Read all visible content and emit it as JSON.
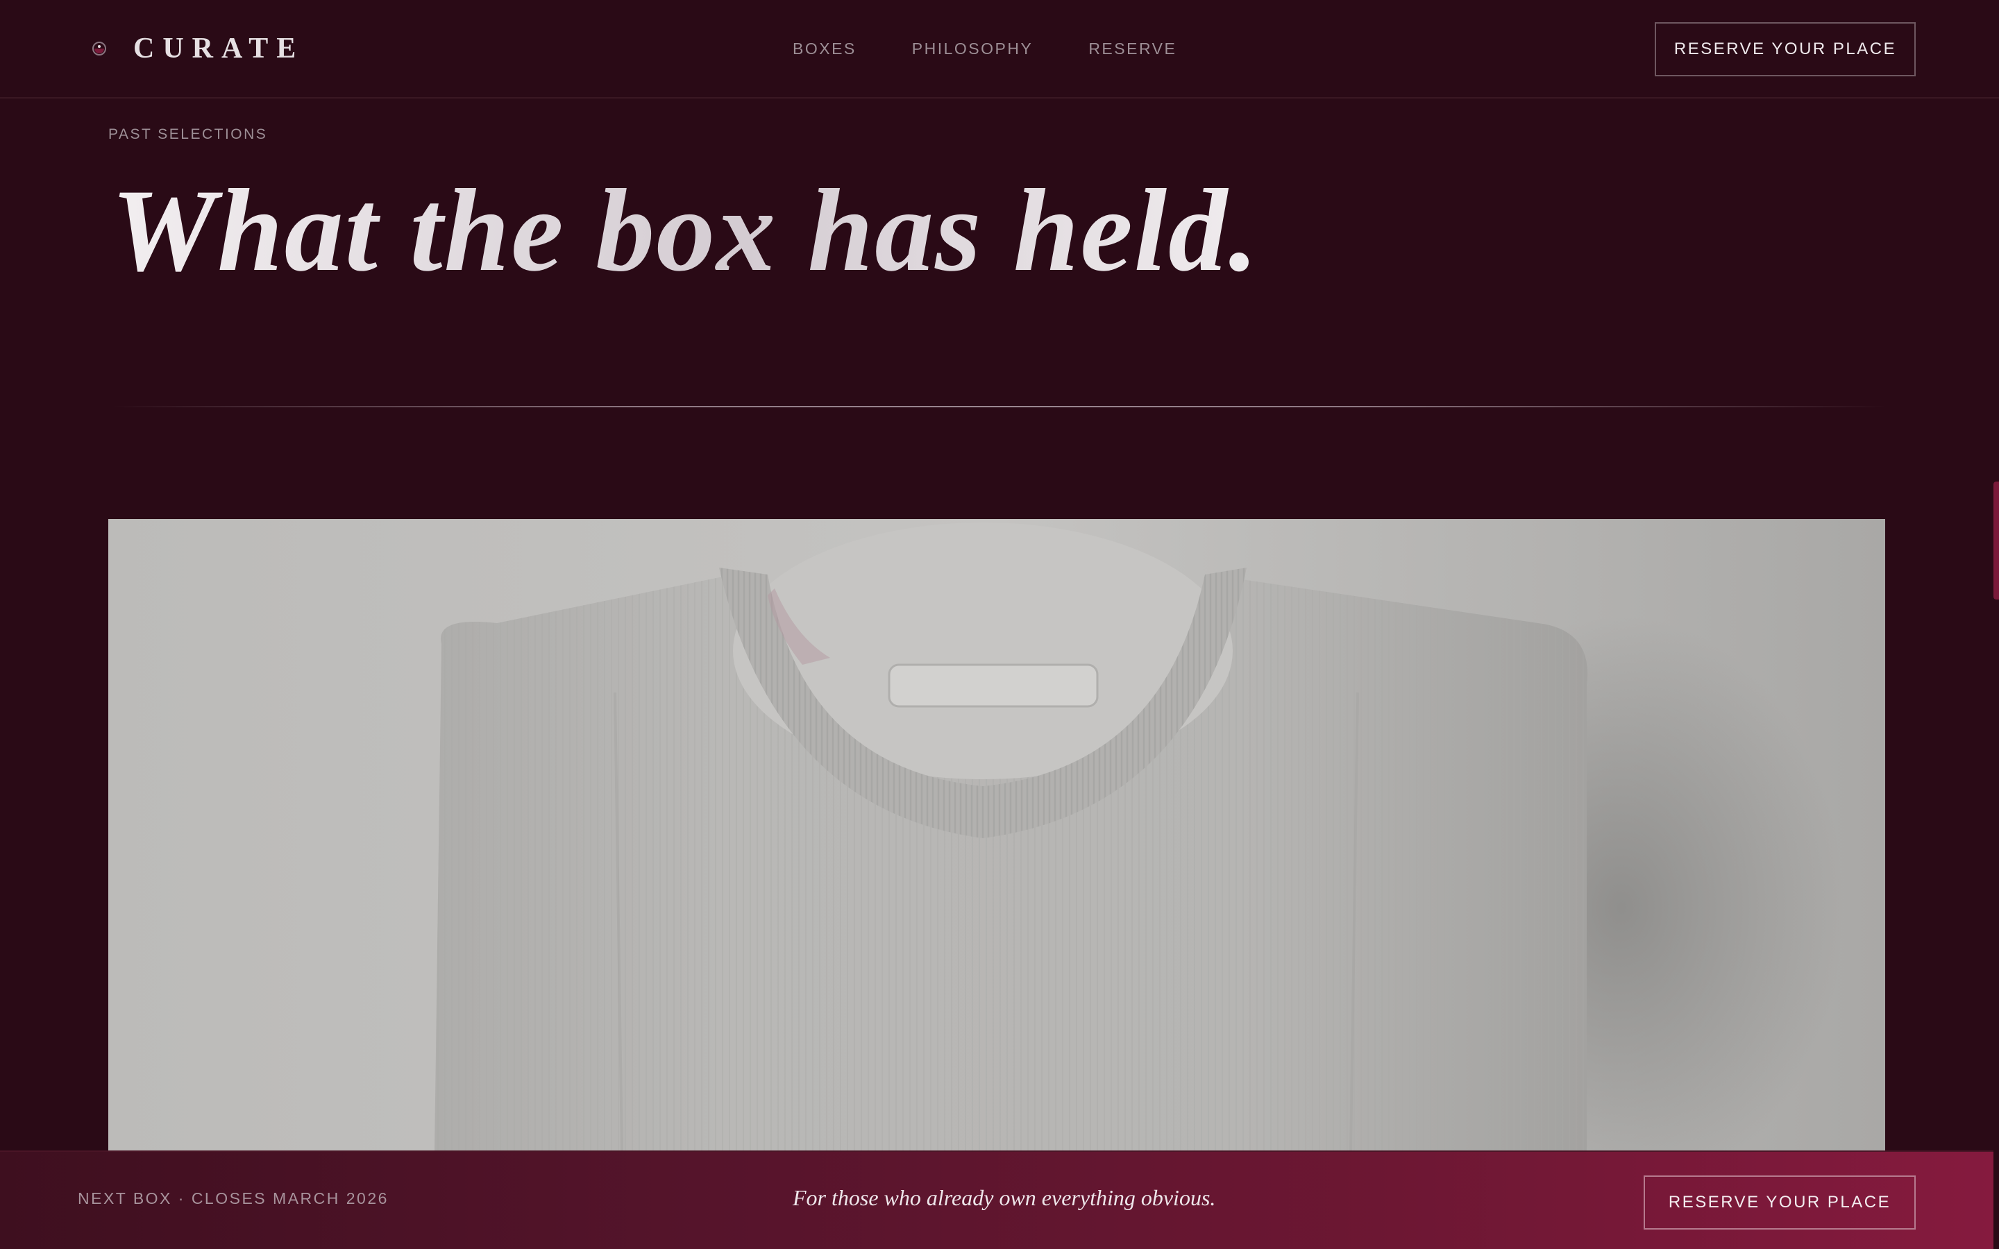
{
  "header": {
    "brand_name": "CURATE",
    "nav": [
      {
        "label": "BOXES"
      },
      {
        "label": "PHILOSOPHY"
      },
      {
        "label": "RESERVE"
      }
    ],
    "cta_label": "RESERVE YOUR PLACE"
  },
  "hero": {
    "eyebrow": "PAST SELECTIONS",
    "title": "What the box has held."
  },
  "feature": {
    "image_icon": "folded-sweater-photo"
  },
  "bottom_bar": {
    "note": "NEXT BOX · CLOSES MARCH 2026",
    "tagline": "For those who already own everything obvious.",
    "cta_label": "RESERVE YOUR PLACE"
  },
  "colors": {
    "background": "#2a0a16",
    "accent": "#851a3e",
    "text": "#e8e3e6",
    "muted": "#9d8f96"
  }
}
